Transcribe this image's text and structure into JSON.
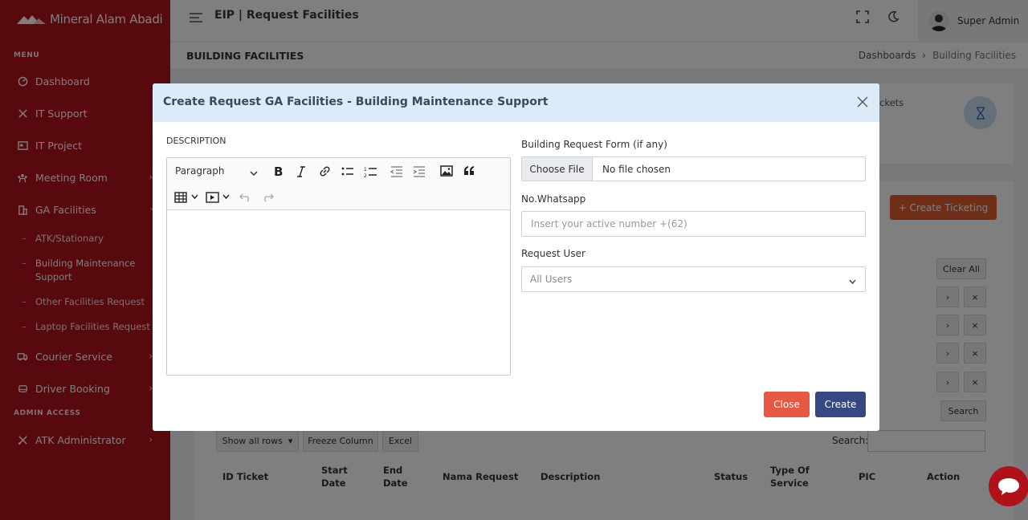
{
  "brand": {
    "name": "Mineral Alam Abadi"
  },
  "sidebar": {
    "menu_heading": "MENU",
    "items": [
      {
        "label": "Dashboard",
        "icon": "dashboard-icon"
      },
      {
        "label": "IT Support",
        "icon": "tools-icon"
      },
      {
        "label": "IT Project",
        "icon": "project-icon"
      },
      {
        "label": "Meeting Room",
        "icon": "meeting-icon"
      },
      {
        "label": "GA Facilities",
        "icon": "building-icon"
      }
    ],
    "ga_sub_items": [
      {
        "label": "ATK/Stationary"
      },
      {
        "label": "Building Maintenance Support"
      },
      {
        "label": "Other Facilities Request"
      },
      {
        "label": "Laptop Facilities Request"
      }
    ],
    "more_items": [
      {
        "label": "Courier Service",
        "icon": "truck-icon"
      },
      {
        "label": "Driver Booking",
        "icon": "car-icon"
      }
    ],
    "admin_heading": "ADMIN ACCESS",
    "admin_items": [
      {
        "label": "ATK Administrator",
        "icon": "admin-tools-icon"
      }
    ]
  },
  "header": {
    "title": "EIP | Request Facilities",
    "user_name": "Super Admin"
  },
  "pagebar": {
    "title": "BUILDING FACILITIES",
    "crumb_root": "Dashboards",
    "crumb_sep": "›",
    "crumb_current": "Building Facilities"
  },
  "background": {
    "tickets_label": "ckets",
    "create_ticketing": "+ Create Ticketing",
    "clear_all": "Clear All",
    "search_btn": "Search",
    "show_all_rows": "Show all rows",
    "freeze_column": "Freeze Column",
    "excel": "Excel",
    "search_label": "Search:",
    "columns": [
      "ID Ticket",
      "Start Date",
      "End Date",
      "Nama Request",
      "Description",
      "Status",
      "Type Of Service",
      "PIC",
      "Action"
    ]
  },
  "modal": {
    "title": "Create Request GA Facilities - Building Maintenance Support",
    "description_label": "DESCRIPTION",
    "editor": {
      "block_format": "Paragraph"
    },
    "form_label": "Building Request Form (if any)",
    "choose_file": "Choose File",
    "file_status": "No file chosen",
    "whatsapp_label": "No.Whatsapp",
    "whatsapp_placeholder": "Insert your active number +(62)",
    "request_user_label": "Request User",
    "request_user_value": "All Users",
    "close_button": "Close",
    "create_button": "Create"
  },
  "colors": {
    "sidebar": "#b0121a",
    "modal_header": "#dcebf8",
    "close_btn": "#e8573f",
    "create_btn": "#364782",
    "create_ticket_btn": "#e05a2f"
  }
}
